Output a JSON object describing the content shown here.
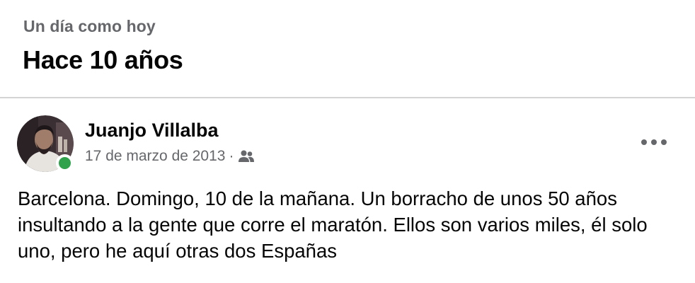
{
  "section": {
    "kicker": "Un día como hoy",
    "heading": "Hace 10 años"
  },
  "post": {
    "author": "Juanjo Villalba",
    "date": "17 de marzo de 2013",
    "separator": "·",
    "audience_icon": "friends-icon",
    "online_status_color": "#31a24c",
    "more_icon": "more-horizontal-icon",
    "text": "Barcelona. Domingo, 10 de la mañana. Un borracho de unos 50 años insultando a la gente que corre el maratón. Ellos son varios miles, él solo uno, pero he aquí otras dos Españas"
  },
  "colors": {
    "secondary_text": "#65676b",
    "primary_text": "#050505",
    "divider": "#d4d4d4"
  }
}
